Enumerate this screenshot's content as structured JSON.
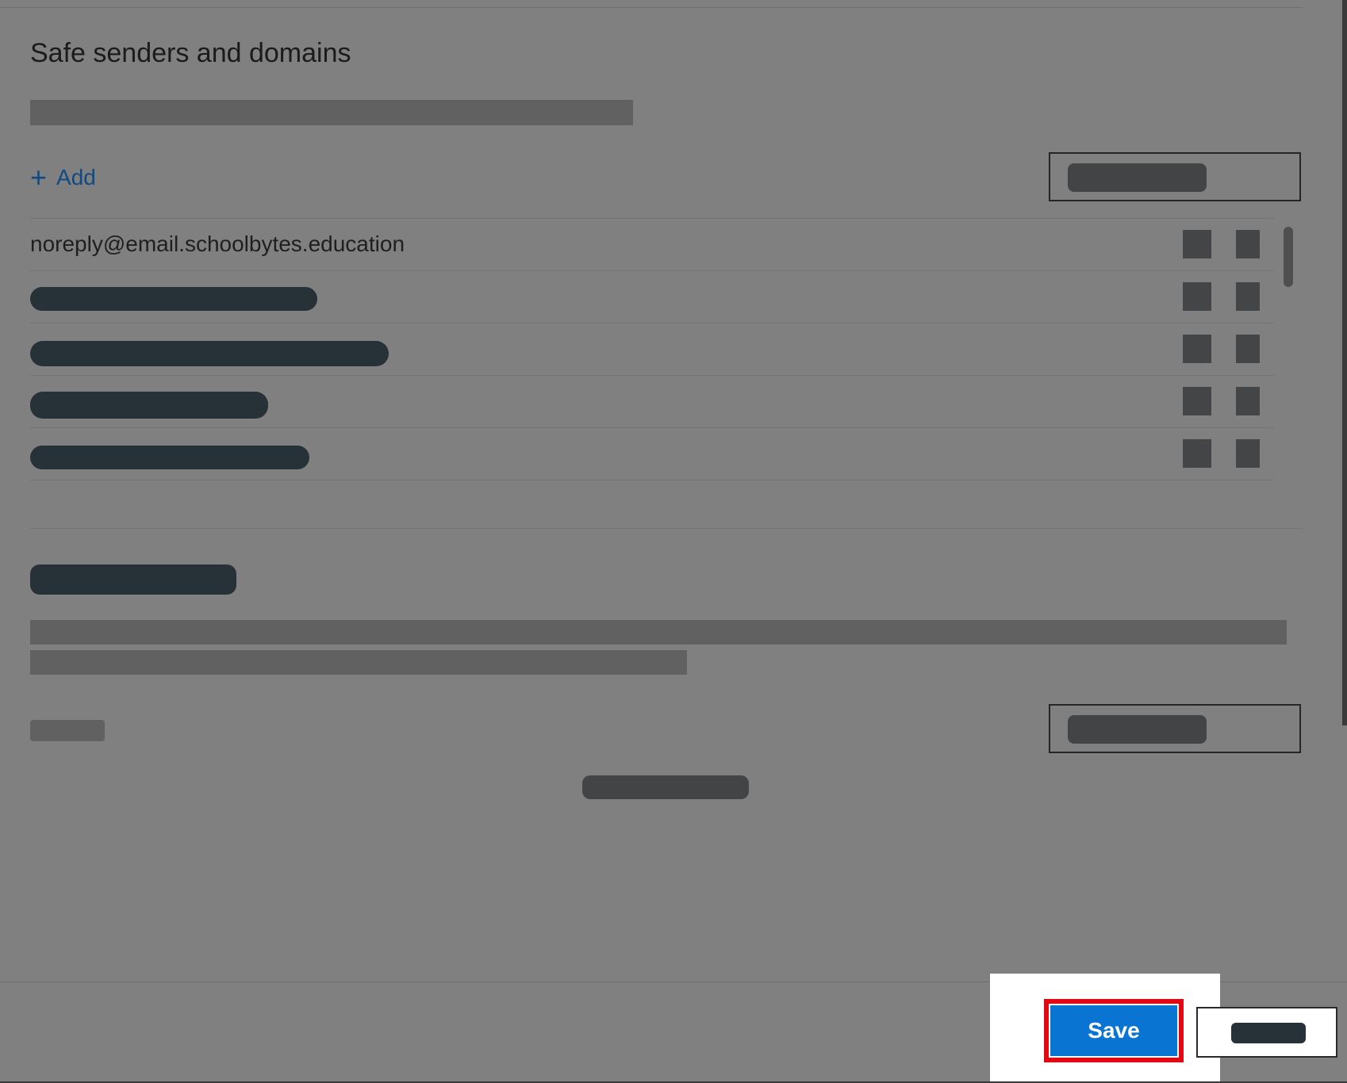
{
  "section": {
    "title": "Safe senders and domains"
  },
  "toolbar": {
    "add_label": "Add",
    "add_icon": "plus-icon"
  },
  "list": {
    "rows": [
      {
        "text": "noreply@email.schoolbytes.education",
        "redacted": false
      },
      {
        "text": "",
        "redacted": true
      },
      {
        "text": "",
        "redacted": true
      },
      {
        "text": "",
        "redacted": true
      },
      {
        "text": "",
        "redacted": true
      }
    ]
  },
  "footer": {
    "save_label": "Save",
    "cancel_label": ""
  },
  "colors": {
    "overlay": "#808080",
    "accent": "#0a74d3",
    "highlight": "#e30613",
    "link": "#0f4a84"
  }
}
